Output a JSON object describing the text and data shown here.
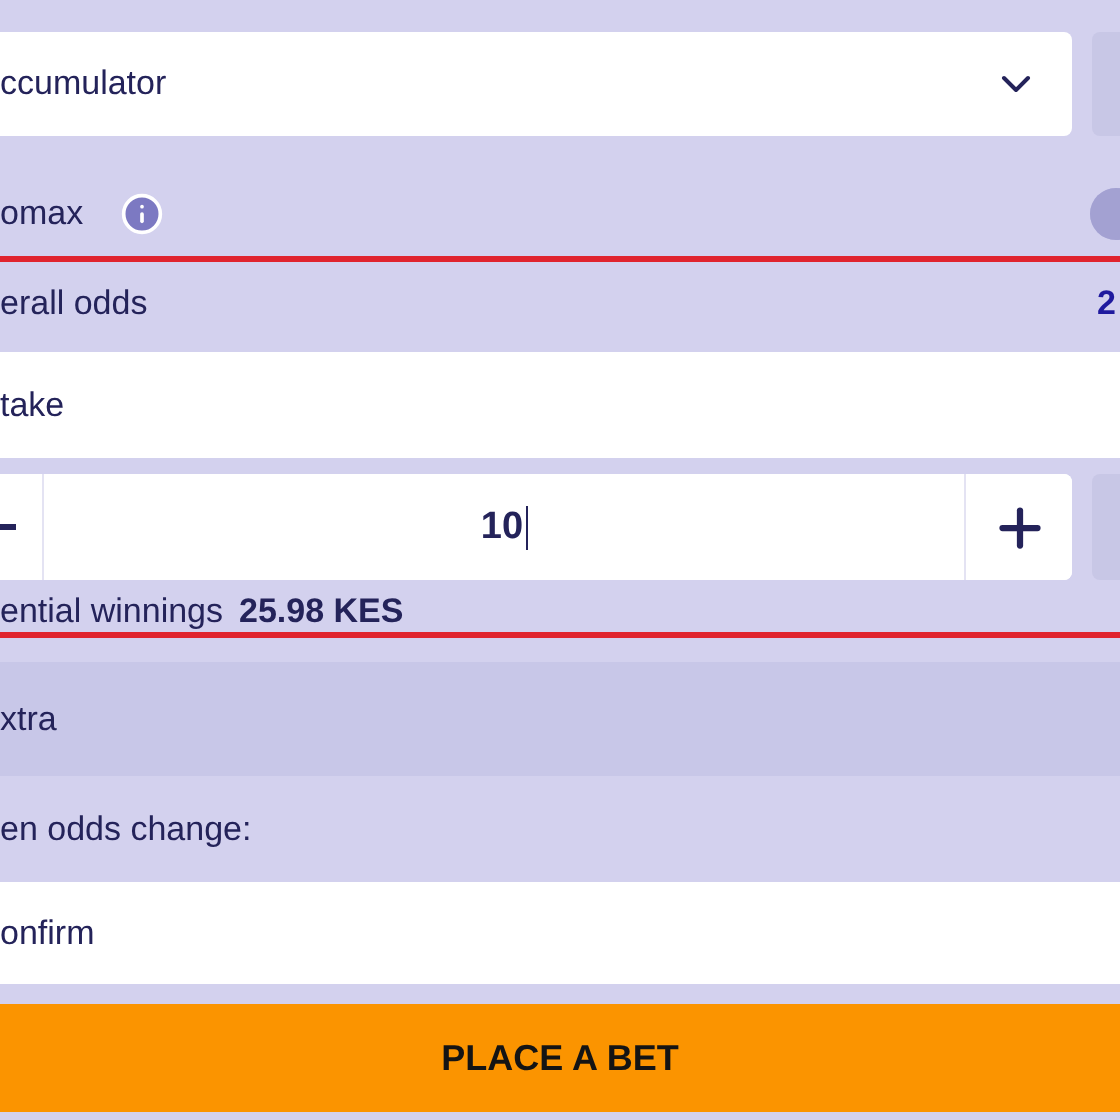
{
  "bet_type": {
    "value": "ccumulator"
  },
  "promax": {
    "label": "omax",
    "toggle": {
      "on": false
    }
  },
  "overall_odds": {
    "label": "erall odds",
    "value": "2"
  },
  "stake": {
    "label": "take",
    "value": "10"
  },
  "potential_winnings": {
    "label": "ential winnings",
    "value": "25.98 KES"
  },
  "extra": {
    "label": "xtra"
  },
  "odds_change": {
    "label": "en odds change:",
    "value": "onfirm"
  },
  "place_bet": {
    "label": "PLACE A BET"
  }
}
